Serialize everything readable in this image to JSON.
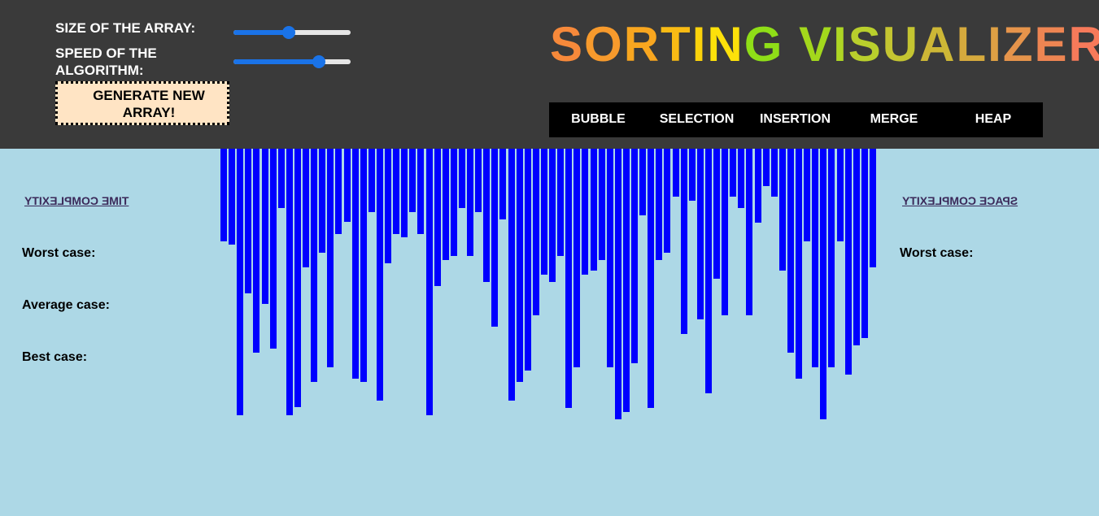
{
  "header": {
    "size_label": "SIZE OF THE ARRAY:",
    "speed_label": "SPEED OF THE ALGORITHM:",
    "size_slider_value": 0.47,
    "speed_slider_value": 0.73,
    "generate_label": "GENERATE NEW ARRAY!",
    "title_letters": [
      {
        "ch": "S",
        "color": "#f7893a"
      },
      {
        "ch": "O",
        "color": "#f79a2c"
      },
      {
        "ch": "R",
        "color": "#f8a61f"
      },
      {
        "ch": "T",
        "color": "#f9bb14"
      },
      {
        "ch": "I",
        "color": "#fbd30b"
      },
      {
        "ch": "N",
        "color": "#fde10a"
      },
      {
        "ch": "G",
        "color": "#8fde17"
      },
      {
        "ch": " ",
        "color": "#ffffff"
      },
      {
        "ch": "V",
        "color": "#a3d81c"
      },
      {
        "ch": "I",
        "color": "#aed624"
      },
      {
        "ch": "S",
        "color": "#b9cf2c"
      },
      {
        "ch": "U",
        "color": "#c4c531"
      },
      {
        "ch": "A",
        "color": "#cdb736"
      },
      {
        "ch": "L",
        "color": "#d6aa3d"
      },
      {
        "ch": "I",
        "color": "#dea044"
      },
      {
        "ch": "Z",
        "color": "#e6944b"
      },
      {
        "ch": "E",
        "color": "#ee8552"
      },
      {
        "ch": "R",
        "color": "#f77a5a"
      }
    ],
    "algorithms": [
      "BUBBLE",
      "SELECTION",
      "INSERTION",
      "MERGE",
      "HEAP"
    ]
  },
  "complexity": {
    "time_link": "TIME COMPLEXITY",
    "space_link": "SPACE COMPLEXITY",
    "worst_case": "Worst case:",
    "average_case": "Average case:",
    "best_case": "Best case:",
    "space_worst_case": "Worst case:"
  },
  "colors": {
    "header_bg": "#3a3a3a",
    "main_bg": "#add8e6",
    "bar": "#0000ff",
    "slider_accent": "#1a73e8",
    "generate_bg": "#ffe4c4"
  },
  "array_values": [
    114,
    118,
    328,
    178,
    251,
    191,
    246,
    73,
    328,
    318,
    146,
    287,
    128,
    269,
    105,
    90,
    283,
    287,
    78,
    310,
    141,
    105,
    109,
    78,
    105,
    328,
    169,
    137,
    132,
    73,
    132,
    78,
    164,
    219,
    87,
    310,
    287,
    273,
    205,
    155,
    164,
    132,
    319,
    269,
    155,
    150,
    137,
    269,
    333,
    324,
    264,
    82,
    319,
    137,
    128,
    59,
    228,
    64,
    210,
    301,
    160,
    205,
    59,
    73,
    205,
    91,
    46,
    59,
    150,
    251,
    283,
    114,
    269,
    333,
    269,
    114,
    278,
    242,
    233,
    146
  ]
}
